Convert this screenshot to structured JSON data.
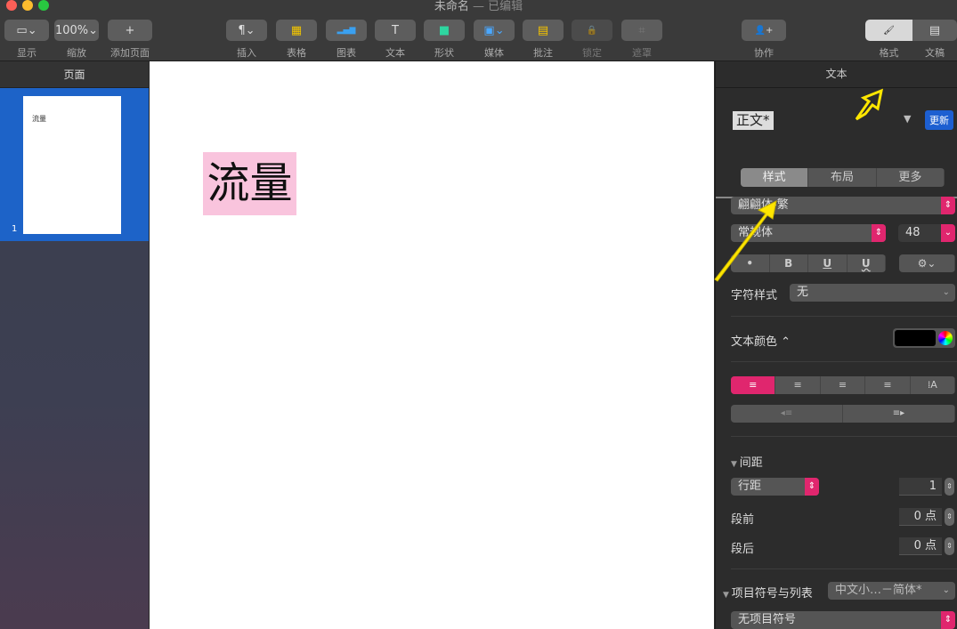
{
  "window": {
    "title": "未命名",
    "edited": "— 已编辑"
  },
  "toolbar": {
    "left": [
      {
        "label": "显示",
        "icon": "▭⌄"
      },
      {
        "label": "缩放",
        "icon": "100%⌄"
      },
      {
        "label": "添加页面",
        "icon": "+"
      }
    ],
    "center": [
      {
        "label": "插入",
        "icon": "¶⌄"
      },
      {
        "label": "表格",
        "icon": "▦"
      },
      {
        "label": "图表",
        "icon": "▂▄▆"
      },
      {
        "label": "文本",
        "icon": "T"
      },
      {
        "label": "形状",
        "icon": "■"
      },
      {
        "label": "媒体",
        "icon": "▣⌄"
      },
      {
        "label": "批注",
        "icon": "▤"
      },
      {
        "label": "锁定",
        "icon": "🔒"
      },
      {
        "label": "遮罩",
        "icon": "⌗"
      }
    ],
    "collab": {
      "label": "协作",
      "icon": "👤+"
    },
    "format": {
      "label": "格式",
      "icon": "🖌"
    },
    "document": {
      "label": "文稿",
      "icon": "▤"
    }
  },
  "sidebar": {
    "header": "页面",
    "pages": [
      {
        "number": "1",
        "preview_text": "流量"
      }
    ]
  },
  "canvas": {
    "text": "流量"
  },
  "inspector": {
    "header": "文本",
    "paragraph_style": "正文*",
    "update_label": "更新",
    "tabs": [
      "样式",
      "布局",
      "更多"
    ],
    "font_family": "翩翩体-繁",
    "font_typeface": "常规体",
    "font_size": "48",
    "style_buttons": [
      "•",
      "B",
      "U",
      "U"
    ],
    "gear": "⚙⌄",
    "char_style_label": "字符样式",
    "char_style_value": "无",
    "text_color_label": "文本颜色 ⌃",
    "text_color": "#000000",
    "align_buttons": [
      "≡",
      "≡",
      "≡",
      "≡",
      "⁞A"
    ],
    "indent_buttons": [
      "◂≡",
      "≡▸"
    ],
    "spacing": {
      "header": "间距",
      "line_mode": "行距",
      "line_value": "1",
      "before_label": "段前",
      "before_value": "0 点",
      "after_label": "段后",
      "after_value": "0 点"
    },
    "bullets": {
      "header": "项目符号与列表",
      "preset": "中文小…－简体*",
      "value": "无项目符号"
    }
  }
}
